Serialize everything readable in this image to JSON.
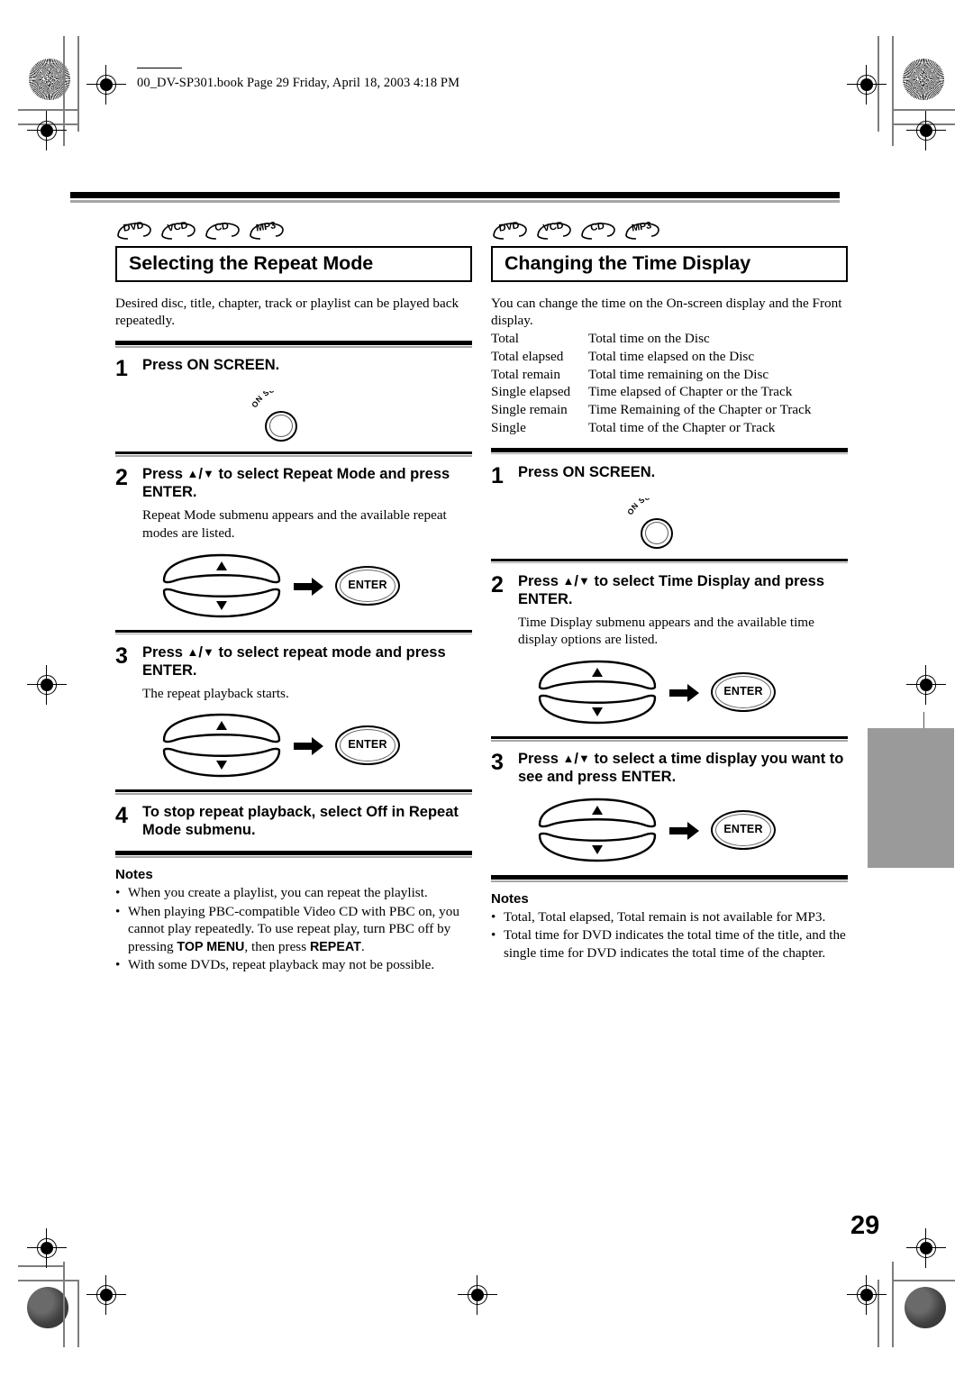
{
  "file_header": "00_DV-SP301.book  Page 29  Friday, April 18, 2003  4:18 PM",
  "page_number": "29",
  "disc_badges": [
    "DVD",
    "VCD",
    "CD",
    "MP3"
  ],
  "icons": {
    "registration_mark": "registration-crosshair-icon",
    "starburst": "star-target-icon",
    "density_dot": "density-patch-icon",
    "arrow_right": "arrow-right-icon",
    "up_triangle": "up-triangle-icon",
    "down_triangle": "down-triangle-icon"
  },
  "colors": {
    "rule_black": "#000000",
    "rule_gray": "#a6a6a6",
    "thumb_tab": "#9a9a9a",
    "text": "#000000"
  },
  "left_column": {
    "title": "Selecting the Repeat Mode",
    "intro": "Desired disc, title, chapter, track or playlist can be played back repeatedly.",
    "steps": [
      {
        "num": "1",
        "heading": "Press ON SCREEN.",
        "desc": "",
        "illustration": "on-screen-button",
        "button_label": "ON SCREEN"
      },
      {
        "num": "2",
        "heading_pre": "Press ",
        "heading_post": " to select Repeat Mode and press ENTER.",
        "desc": "Repeat Mode submenu appears and the available repeat modes are listed.",
        "illustration": "nav-enter-buttons",
        "enter_label": "ENTER"
      },
      {
        "num": "3",
        "heading_pre": "Press ",
        "heading_post": " to select repeat mode and press ENTER.",
        "desc": "The repeat playback starts.",
        "illustration": "nav-enter-buttons",
        "enter_label": "ENTER"
      },
      {
        "num": "4",
        "heading": "To stop repeat playback, select Off in Repeat Mode submenu.",
        "desc": "",
        "illustration": "none"
      }
    ],
    "notes_title": "Notes",
    "notes": [
      {
        "parts": [
          {
            "t": "When you create a playlist, you can repeat the playlist.",
            "b": false
          }
        ]
      },
      {
        "parts": [
          {
            "t": "When playing PBC-compatible Video CD with PBC on, you cannot play repeatedly. To use repeat play, turn PBC off by pressing ",
            "b": false
          },
          {
            "t": "TOP MENU",
            "b": true
          },
          {
            "t": ", then press ",
            "b": false
          },
          {
            "t": "REPEAT",
            "b": true
          },
          {
            "t": ".",
            "b": false
          }
        ]
      },
      {
        "parts": [
          {
            "t": "With some DVDs, repeat playback may not be possible.",
            "b": false
          }
        ]
      }
    ]
  },
  "right_column": {
    "title": "Changing the Time Display",
    "intro": "You can change the time on the On-screen display and the Front display.",
    "definitions": [
      {
        "term": "Total",
        "desc": "Total time on the Disc"
      },
      {
        "term": "Total elapsed",
        "desc": "Total time elapsed on the Disc"
      },
      {
        "term": "Total remain",
        "desc": "Total time remaining on the Disc"
      },
      {
        "term": "Single elapsed",
        "desc": "Time elapsed of Chapter or the Track"
      },
      {
        "term": "Single remain",
        "desc": "Time Remaining of the Chapter or Track"
      },
      {
        "term": "Single",
        "desc": "Total time of the Chapter or Track"
      }
    ],
    "steps": [
      {
        "num": "1",
        "heading": "Press ON SCREEN.",
        "desc": "",
        "illustration": "on-screen-button",
        "button_label": "ON SCREEN"
      },
      {
        "num": "2",
        "heading_pre": "Press ",
        "heading_post": " to select Time Display and press ENTER.",
        "desc": "Time Display submenu appears and the available time display options are listed.",
        "illustration": "nav-enter-buttons",
        "enter_label": "ENTER"
      },
      {
        "num": "3",
        "heading_pre": "Press ",
        "heading_post": " to select a time display you want to see and press ENTER.",
        "desc": "",
        "illustration": "nav-enter-buttons",
        "enter_label": "ENTER"
      }
    ],
    "notes_title": "Notes",
    "notes": [
      {
        "parts": [
          {
            "t": "Total, Total elapsed, Total remain is not available for MP3.",
            "b": false
          }
        ]
      },
      {
        "parts": [
          {
            "t": "Total time for DVD indicates the total time of the title, and the single time for DVD indicates the total time of the chapter.",
            "b": false
          }
        ]
      }
    ]
  }
}
